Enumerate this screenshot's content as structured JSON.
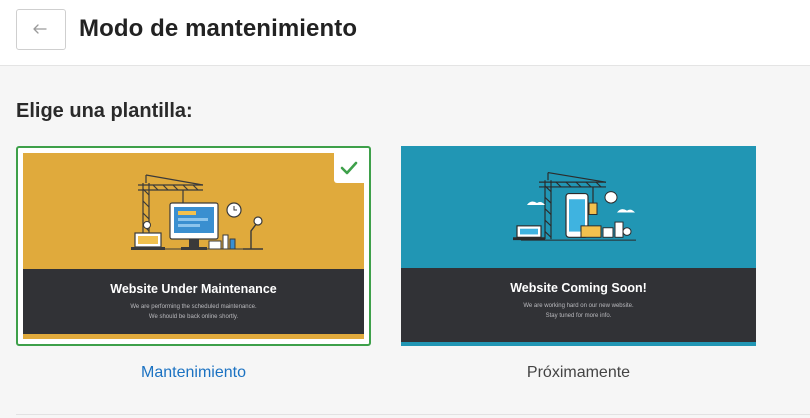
{
  "header": {
    "back_icon": "back-arrow-icon",
    "title": "Modo de mantenimiento"
  },
  "section": {
    "title": "Elige una plantilla:"
  },
  "templates": [
    {
      "caption": "Mantenimiento",
      "selected": true,
      "preview_title": "Website Under Maintenance",
      "preview_line1": "We are performing the scheduled maintenance.",
      "preview_line2": "We should be back online shortly.",
      "bg_color": "#e0aa3c",
      "icon": "construction-crane-computer-illustration"
    },
    {
      "caption": "Próximamente",
      "selected": false,
      "preview_title": "Website Coming Soon!",
      "preview_line1": "We are working hard on our new website.",
      "preview_line2": "Stay tuned for more info.",
      "bg_color": "#2196b4",
      "icon": "construction-crane-phone-illustration"
    }
  ],
  "colors": {
    "selected_border": "#3ea04a",
    "link": "#1b72c2",
    "dark_band": "#313236"
  }
}
